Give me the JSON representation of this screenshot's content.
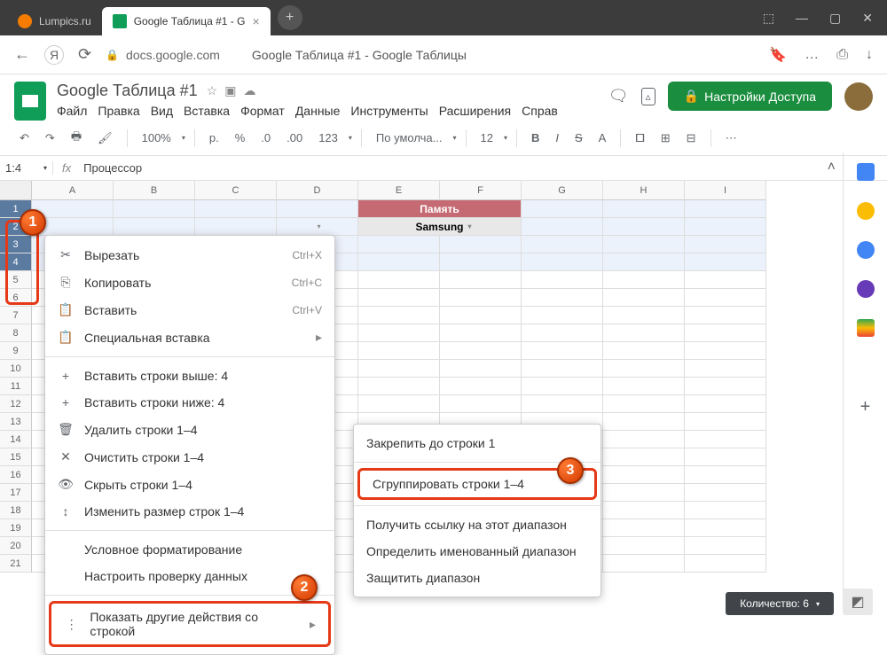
{
  "browser": {
    "tabs": [
      {
        "label": "Lumpics.ru",
        "active": false
      },
      {
        "label": "Google Таблица #1 - G",
        "active": true
      }
    ],
    "url_host": "docs.google.com",
    "page_title": "Google Таблица #1 - Google Таблицы"
  },
  "app": {
    "doc_title": "Google Таблица #1",
    "menus": [
      "Файл",
      "Правка",
      "Вид",
      "Вставка",
      "Формат",
      "Данные",
      "Инструменты",
      "Расширения",
      "Справ"
    ],
    "share_label": "Настройки Доступа"
  },
  "toolbar": {
    "zoom": "100%",
    "currency": "р.",
    "percent": "%",
    "dec_dec": ".0",
    "dec_inc": ".00",
    "format_menu": "123",
    "font": "По умолча...",
    "font_size": "12"
  },
  "formula_bar": {
    "name_box": "1:4",
    "value": "Процессор"
  },
  "sheet": {
    "columns": [
      "A",
      "B",
      "C",
      "D",
      "E",
      "F",
      "G",
      "H",
      "I"
    ],
    "selected_rows": [
      1,
      2,
      3,
      4
    ],
    "row_count": 21,
    "memory_header": "Память",
    "samsung_label": "Samsung"
  },
  "context_menu": {
    "cut": "Вырезать",
    "cut_sc": "Ctrl+X",
    "copy": "Копировать",
    "copy_sc": "Ctrl+C",
    "paste": "Вставить",
    "paste_sc": "Ctrl+V",
    "paste_special": "Специальная вставка",
    "insert_above": "Вставить строки выше: 4",
    "insert_below": "Вставить строки ниже: 4",
    "delete_rows": "Удалить строки 1–4",
    "clear_rows": "Очистить строки 1–4",
    "hide_rows": "Скрыть строки 1–4",
    "resize_rows": "Изменить размер строк 1–4",
    "cond_format": "Условное форматирование",
    "data_valid": "Настроить проверку данных",
    "more_actions": "Показать другие действия со строкой"
  },
  "submenu": {
    "freeze": "Закрепить до строки 1",
    "group": "Сгруппировать строки 1–4",
    "get_link": "Получить ссылку на этот диапазон",
    "named_range": "Определить именованный диапазон",
    "protect": "Защитить диапазон"
  },
  "status": {
    "count_label": "Количество: 6"
  },
  "badges": {
    "b1": "1",
    "b2": "2",
    "b3": "3"
  }
}
